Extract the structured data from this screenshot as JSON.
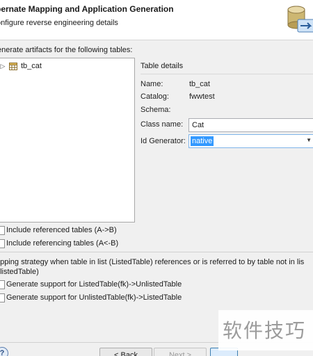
{
  "header": {
    "title": "bernate Mapping and Application Generation",
    "subtitle": "onfigure reverse engineering details",
    "icon": "database-wizard-icon"
  },
  "tables_section": {
    "label": "enerate artifacts for the following tables:",
    "tree_items": [
      {
        "label": "tb_cat",
        "icon": "table-icon",
        "expand_icon": "tree-expand-arrow"
      }
    ]
  },
  "details": {
    "title": "Table details",
    "name_label": "Name:",
    "name_value": "tb_cat",
    "catalog_label": "Catalog:",
    "catalog_value": "fwwtest",
    "schema_label": "Schema:",
    "schema_value": "",
    "classname_label": "Class name:",
    "classname_value": "Cat",
    "idgen_label": "Id Generator:",
    "idgen_value": "native"
  },
  "options": {
    "include_referenced": "Include referenced tables (A->B)",
    "include_referencing": "Include referencing tables (A<-B)"
  },
  "strategy": {
    "text": "apping strategy when table in list (ListedTable) references or is referred to by table not in lis nlistedTable)",
    "opt_listed_unlisted": "Generate support for ListedTable(fk)->UnlistedTable",
    "opt_unlisted_listed": "Generate support for UnlistedTable(fk)->ListedTable"
  },
  "footer": {
    "help_label": "?",
    "back_label": "< Back",
    "next_label": "Next >"
  },
  "watermark": {
    "text": "软件技巧"
  },
  "colors": {
    "selection": "#3399ff",
    "dialog_bg": "#f0f0f0",
    "header_bg": "#ffffff"
  }
}
